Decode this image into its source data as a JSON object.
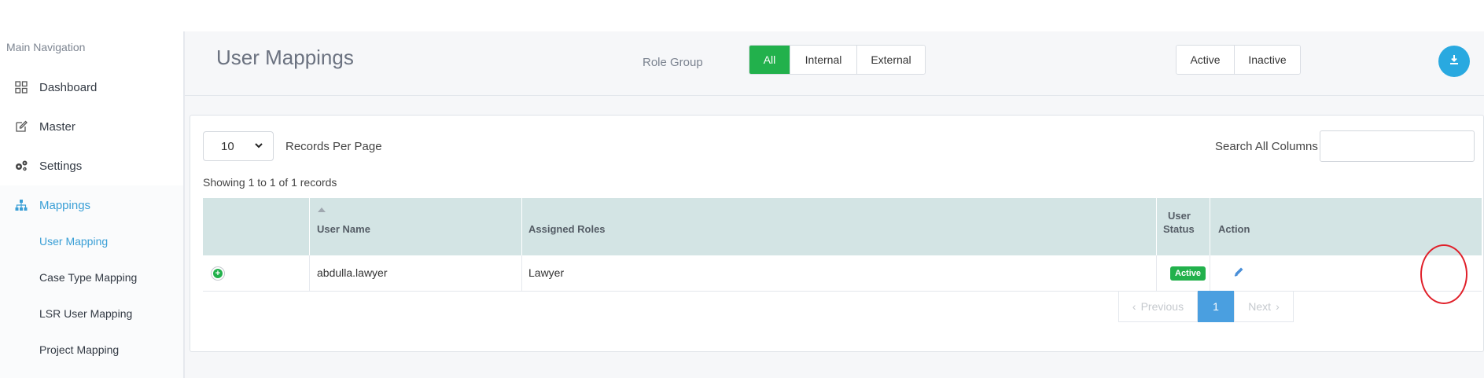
{
  "sidebar": {
    "title": "Main Navigation",
    "items": [
      {
        "label": "Dashboard",
        "icon": "grid-icon"
      },
      {
        "label": "Master",
        "icon": "edit-icon"
      },
      {
        "label": "Settings",
        "icon": "gears-icon"
      },
      {
        "label": "Mappings",
        "icon": "sitemap-icon"
      }
    ],
    "sub_items": [
      {
        "label": "User Mapping"
      },
      {
        "label": "Case Type Mapping"
      },
      {
        "label": "LSR User Mapping"
      },
      {
        "label": "Project Mapping"
      }
    ]
  },
  "header": {
    "title": "User Mappings",
    "role_group_label": "Role Group",
    "role_groups": [
      {
        "label": "All"
      },
      {
        "label": "Internal"
      },
      {
        "label": "External"
      }
    ],
    "status_filters": [
      {
        "label": "Active"
      },
      {
        "label": "Inactive"
      }
    ],
    "download_icon": "download-icon"
  },
  "table_controls": {
    "records_per_page_value": "10",
    "records_per_page_label": "Records Per Page",
    "search_label": "Search All Columns",
    "search_value": "",
    "showing_text": "Showing 1 to 1 of 1 records"
  },
  "table": {
    "columns": [
      "User Name",
      "Assigned Roles",
      "User",
      "Status",
      "Action"
    ],
    "rows": [
      {
        "user_name": "abdulla.lawyer",
        "assigned_roles": "Lawyer",
        "status": "Active"
      }
    ]
  },
  "pagination": {
    "previous": "Previous",
    "current": "1",
    "next": "Next"
  },
  "colors": {
    "accent": "#3a9fd6",
    "success": "#22b14c",
    "header_bg": "#d3e4e4",
    "annotation": "#e0202a"
  }
}
